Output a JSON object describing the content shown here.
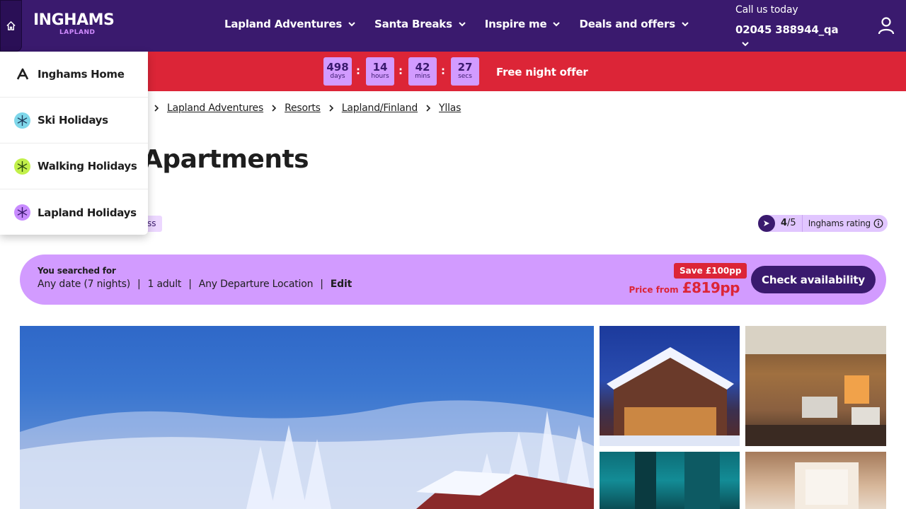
{
  "header": {
    "logo_main": "INGHAMS",
    "logo_sub": "LAPLAND",
    "nav": [
      {
        "label": "Lapland Adventures",
        "icon": "chevron-down-icon"
      },
      {
        "label": "Santa Breaks",
        "icon": "chevron-down-icon"
      },
      {
        "label": "Inspire me",
        "icon": "chevron-down-icon"
      },
      {
        "label": "Deals and offers",
        "icon": "chevron-down-icon"
      }
    ],
    "call_label": "Call us today",
    "call_number": "02045 388944_qa",
    "home_icon": "home-icon",
    "account_icon": "user-icon"
  },
  "promo": {
    "countdown": [
      {
        "value": "498",
        "unit": "days"
      },
      {
        "value": "14",
        "unit": "hours"
      },
      {
        "value": "42",
        "unit": "mins"
      },
      {
        "value": "27",
        "unit": "secs"
      }
    ],
    "separator": ":",
    "offer_label": "Free night offer",
    "bg_color": "#dc2537",
    "box_color": "#d29bff"
  },
  "breadcrumb": [
    "Lapland Adventures",
    "Resorts",
    "Lapland/Finland",
    "Yllas"
  ],
  "title": "Apartments",
  "tag_fragment": "ss",
  "rating": {
    "score": "4",
    "out_of": "/5",
    "label": "Inghams rating"
  },
  "search": {
    "heading": "You searched for",
    "date": "Any date (7 nights)",
    "guests": "1 adult",
    "departure": "Any Departure Location",
    "edit_label": "Edit",
    "save_badge": "Save £100pp",
    "price_label": "Price from",
    "price_value": "£819pp",
    "cta_label": "Check availability"
  },
  "dropdown": {
    "items": [
      {
        "label": "Inghams Home",
        "icon": "inghams-logo-icon"
      },
      {
        "label": "Ski Holidays",
        "icon": "snowflake-icon"
      },
      {
        "label": "Walking Holidays",
        "icon": "walking-icon"
      },
      {
        "label": "Lapland Holidays",
        "icon": "lapland-icon"
      }
    ]
  },
  "colors": {
    "brand_purple": "#3a1a6e",
    "accent_lilac": "#d29bff",
    "alert_red": "#dc2537"
  }
}
